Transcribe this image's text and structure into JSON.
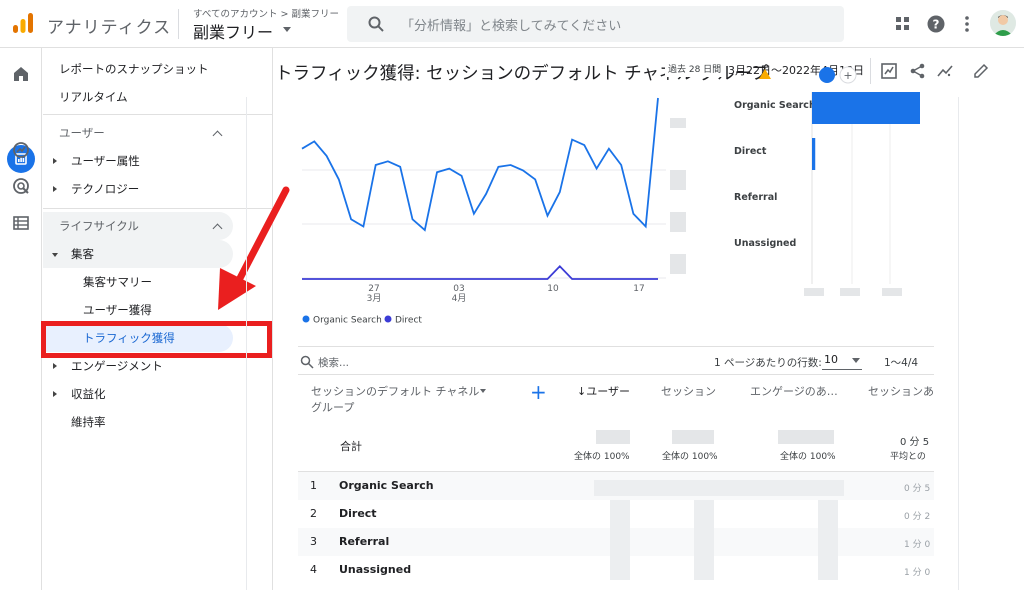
{
  "app": {
    "name": "アナリティクス",
    "breadcrumb": "すべてのアカウント > 副業フリー",
    "property": "副業フリー"
  },
  "search": {
    "placeholder": "「分析情報」と検索してみてください"
  },
  "nav": {
    "snapshot": "レポートのスナップショット",
    "realtime": "リアルタイム",
    "user_section": "ユーザー",
    "user_attributes": "ユーザー属性",
    "technology": "テクノロジー",
    "lifecycle_section": "ライフサイクル",
    "acquisition": "集客",
    "acquisition_overview": "集客サマリー",
    "user_acquisition": "ユーザー獲得",
    "traffic_acquisition": "トラフィック獲得",
    "engagement": "エンゲージメント",
    "monetization": "収益化",
    "retention": "維持率"
  },
  "page": {
    "title": "トラフィック獲得: セッションのデフォルト チャネル グループ",
    "date_label": "過去 28 日間",
    "date_range": "3月22日～2022年4月18日"
  },
  "chart_data": {
    "type": "line",
    "x_ticks": [
      {
        "day": "27",
        "month": "3月"
      },
      {
        "day": "03",
        "month": "4月"
      },
      {
        "day": "10",
        "month": ""
      },
      {
        "day": "17",
        "month": ""
      }
    ],
    "legend": [
      "Organic Search",
      "Direct"
    ],
    "series": [
      {
        "name": "Organic Search",
        "color": "#1a73e8",
        "values": [
          0.72,
          0.76,
          0.68,
          0.55,
          0.33,
          0.29,
          0.63,
          0.65,
          0.62,
          0.33,
          0.27,
          0.59,
          0.61,
          0.57,
          0.36,
          0.47,
          0.62,
          0.63,
          0.6,
          0.55,
          0.35,
          0.48,
          0.77,
          0.74,
          0.61,
          0.72,
          0.63,
          0.36,
          0.29,
          1.0
        ]
      },
      {
        "name": "Direct",
        "color": "#3c3cd6",
        "values": [
          0.0,
          0.0,
          0.0,
          0.0,
          0.0,
          0.0,
          0.0,
          0.0,
          0.0,
          0.0,
          0.0,
          0.0,
          0.0,
          0.0,
          0.0,
          0.0,
          0.0,
          0.0,
          0.0,
          0.0,
          0.0,
          0.07,
          0.0,
          0.0,
          0.0,
          0.0,
          0.0,
          0.0,
          0.0,
          0.0
        ]
      }
    ],
    "bar_chart": {
      "type": "bar",
      "orientation": "horizontal",
      "categories": [
        "Organic Search",
        "Direct",
        "Referral",
        "Unassigned"
      ],
      "values": [
        1.0,
        0.03,
        0.0,
        0.0
      ],
      "color": "#1a73e8"
    }
  },
  "table": {
    "search_placeholder": "検索...",
    "rows_per_page_label": "1 ページあたりの行数:",
    "rows_per_page": "10",
    "pager": "1～4/4",
    "columns": {
      "dimension_line1": "セッションのデフォルト チャネル",
      "dimension_line2": "グループ",
      "users": "↓ユーザー",
      "sessions": "セッション",
      "engaged": "エンゲージのあ…",
      "per_session": "セッションあ"
    },
    "total_label": "合計",
    "total_pct": "全体の 100%",
    "total_tail_top": "0 分 5",
    "total_tail_bottom": "平均との",
    "rows": [
      {
        "num": "1",
        "name": "Organic Search",
        "tail": "0 分 5"
      },
      {
        "num": "2",
        "name": "Direct",
        "tail": "0 分 2"
      },
      {
        "num": "3",
        "name": "Referral",
        "tail": "1 分 0"
      },
      {
        "num": "4",
        "name": "Unassigned",
        "tail": "1 分 0"
      }
    ]
  },
  "colors": {
    "accent": "#1a73e8",
    "highlight": "#ea1f1f"
  }
}
